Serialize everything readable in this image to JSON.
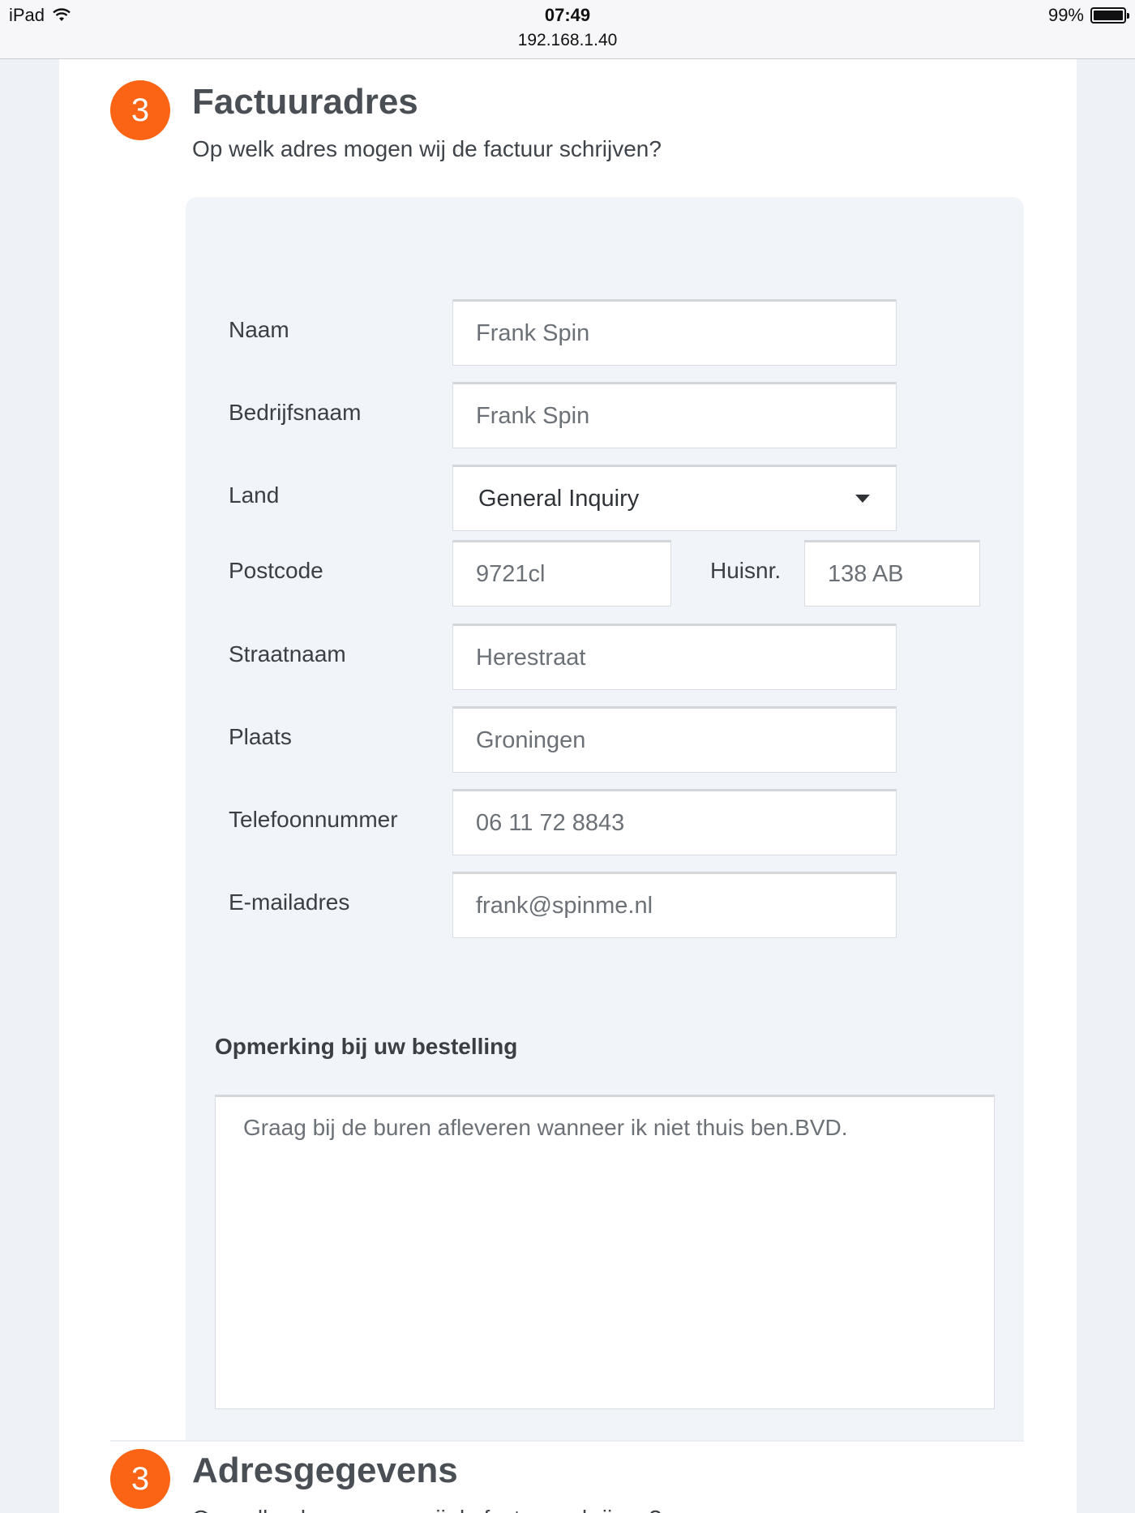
{
  "statusbar": {
    "device": "iPad",
    "time": "07:49",
    "url": "192.168.1.40",
    "battery": "99%",
    "battery_level": 0.99
  },
  "section1": {
    "step": "3",
    "title": "Factuuradres",
    "subtitle": "Op welk adres mogen wij de factuur schrijven?"
  },
  "form": {
    "naam": {
      "label": "Naam",
      "value": "Frank Spin"
    },
    "bedrijfsnaam": {
      "label": "Bedrijfsnaam",
      "value": "Frank Spin"
    },
    "land": {
      "label": "Land",
      "value": "General Inquiry"
    },
    "postcode": {
      "label": "Postcode",
      "value": "9721cl"
    },
    "huisnr": {
      "label": "Huisnr.",
      "value": "138 AB"
    },
    "straatnaam": {
      "label": "Straatnaam",
      "value": "Herestraat"
    },
    "plaats": {
      "label": "Plaats",
      "value": "Groningen"
    },
    "telefoon": {
      "label": "Telefoonnummer",
      "value": "06 11 72 8843"
    },
    "email": {
      "label": "E-mailadres",
      "value": "frank@spinme.nl"
    }
  },
  "note": {
    "title": "Opmerking bij uw bestelling",
    "value": "Graag bij de buren afleveren wanneer ik niet thuis ben.BVD."
  },
  "section2": {
    "step": "3",
    "title": "Adresgegevens",
    "subtitle": "Op welk adres mogen wij de factuur schrijven?"
  },
  "colors": {
    "accent": "#fb6414",
    "card": "#f1f4f8",
    "background": "#eef2f7"
  }
}
